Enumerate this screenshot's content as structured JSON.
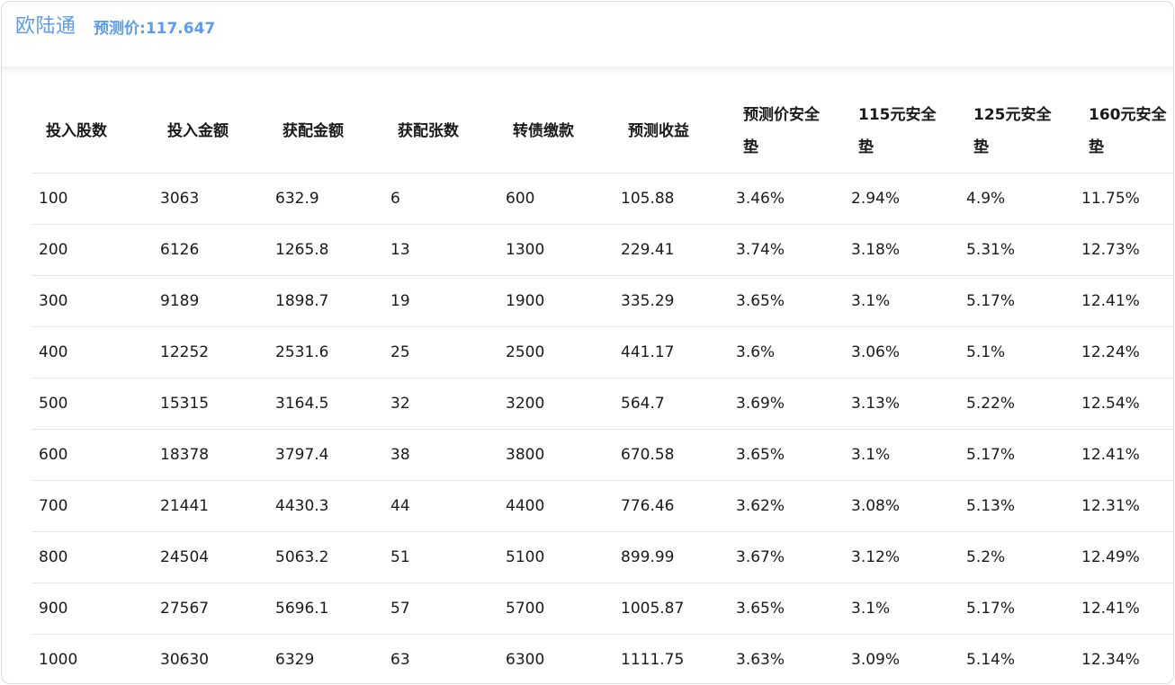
{
  "header": {
    "title": "欧陆通",
    "predict_label": "预测价:",
    "predict_value": "117.647"
  },
  "table": {
    "columns": [
      "投入股数",
      "投入金额",
      "获配金额",
      "获配张数",
      "转债缴款",
      "预测收益",
      "预测价安全垫",
      "115元安全垫",
      "125元安全垫",
      "160元安全垫"
    ],
    "rows": [
      [
        "100",
        "3063",
        "632.9",
        "6",
        "600",
        "105.88",
        "3.46%",
        "2.94%",
        "4.9%",
        "11.75%"
      ],
      [
        "200",
        "6126",
        "1265.8",
        "13",
        "1300",
        "229.41",
        "3.74%",
        "3.18%",
        "5.31%",
        "12.73%"
      ],
      [
        "300",
        "9189",
        "1898.7",
        "19",
        "1900",
        "335.29",
        "3.65%",
        "3.1%",
        "5.17%",
        "12.41%"
      ],
      [
        "400",
        "12252",
        "2531.6",
        "25",
        "2500",
        "441.17",
        "3.6%",
        "3.06%",
        "5.1%",
        "12.24%"
      ],
      [
        "500",
        "15315",
        "3164.5",
        "32",
        "3200",
        "564.7",
        "3.69%",
        "3.13%",
        "5.22%",
        "12.54%"
      ],
      [
        "600",
        "18378",
        "3797.4",
        "38",
        "3800",
        "670.58",
        "3.65%",
        "3.1%",
        "5.17%",
        "12.41%"
      ],
      [
        "700",
        "21441",
        "4430.3",
        "44",
        "4400",
        "776.46",
        "3.62%",
        "3.08%",
        "5.13%",
        "12.31%"
      ],
      [
        "800",
        "24504",
        "5063.2",
        "51",
        "5100",
        "899.99",
        "3.67%",
        "3.12%",
        "5.2%",
        "12.49%"
      ],
      [
        "900",
        "27567",
        "5696.1",
        "57",
        "5700",
        "1005.87",
        "3.65%",
        "3.1%",
        "5.17%",
        "12.41%"
      ],
      [
        "1000",
        "30630",
        "6329",
        "63",
        "6300",
        "1111.75",
        "3.63%",
        "3.09%",
        "5.14%",
        "12.34%"
      ]
    ]
  }
}
